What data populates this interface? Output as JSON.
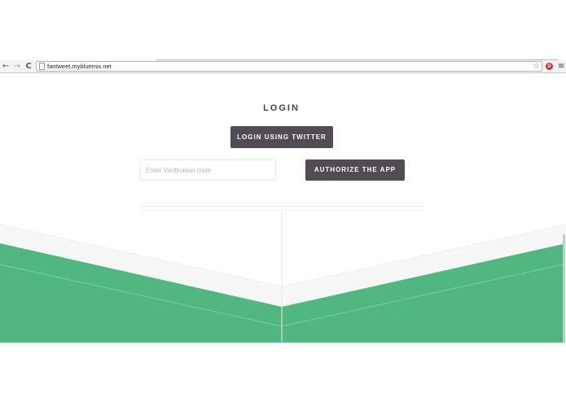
{
  "browser": {
    "url": "fantweet.mybluemix.net",
    "nav": {
      "back_icon": "←",
      "forward_icon": "→",
      "reload_icon": "C"
    },
    "star_icon": "☆",
    "extension_icon": "0",
    "menu_icon": "≡"
  },
  "login": {
    "title": "LOGIN",
    "twitter_button_label": "LOGIN USING TWITTER",
    "verification_placeholder": "Enter Verification code",
    "verification_value": "",
    "authorize_button_label": "AUTHORIZE THE APP"
  },
  "colors": {
    "button_bg": "#514c54",
    "accent_green": "#4fb77f",
    "band_gray": "#f7f7f7"
  }
}
